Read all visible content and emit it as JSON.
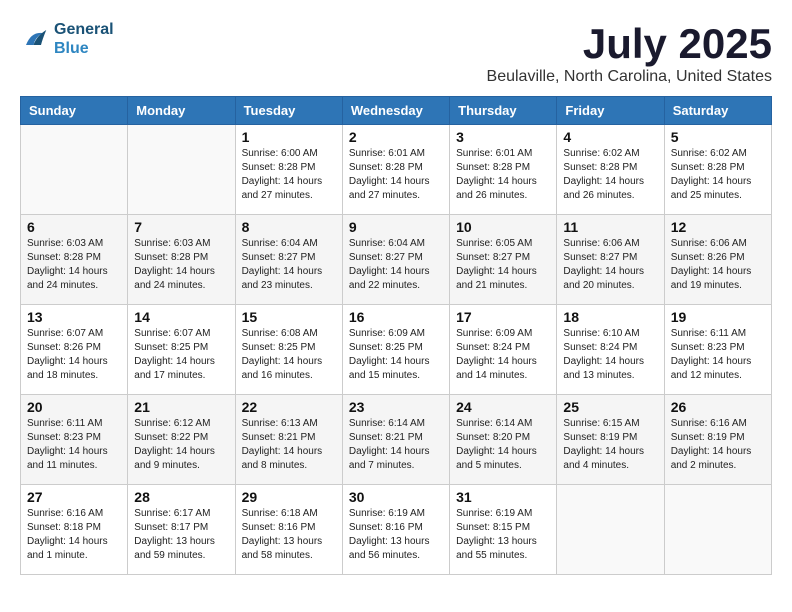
{
  "header": {
    "logo_line1": "General",
    "logo_line2": "Blue",
    "month": "July 2025",
    "location": "Beulaville, North Carolina, United States"
  },
  "weekdays": [
    "Sunday",
    "Monday",
    "Tuesday",
    "Wednesday",
    "Thursday",
    "Friday",
    "Saturday"
  ],
  "weeks": [
    [
      {
        "day": "",
        "info": ""
      },
      {
        "day": "",
        "info": ""
      },
      {
        "day": "1",
        "info": "Sunrise: 6:00 AM\nSunset: 8:28 PM\nDaylight: 14 hours\nand 27 minutes."
      },
      {
        "day": "2",
        "info": "Sunrise: 6:01 AM\nSunset: 8:28 PM\nDaylight: 14 hours\nand 27 minutes."
      },
      {
        "day": "3",
        "info": "Sunrise: 6:01 AM\nSunset: 8:28 PM\nDaylight: 14 hours\nand 26 minutes."
      },
      {
        "day": "4",
        "info": "Sunrise: 6:02 AM\nSunset: 8:28 PM\nDaylight: 14 hours\nand 26 minutes."
      },
      {
        "day": "5",
        "info": "Sunrise: 6:02 AM\nSunset: 8:28 PM\nDaylight: 14 hours\nand 25 minutes."
      }
    ],
    [
      {
        "day": "6",
        "info": "Sunrise: 6:03 AM\nSunset: 8:28 PM\nDaylight: 14 hours\nand 24 minutes."
      },
      {
        "day": "7",
        "info": "Sunrise: 6:03 AM\nSunset: 8:28 PM\nDaylight: 14 hours\nand 24 minutes."
      },
      {
        "day": "8",
        "info": "Sunrise: 6:04 AM\nSunset: 8:27 PM\nDaylight: 14 hours\nand 23 minutes."
      },
      {
        "day": "9",
        "info": "Sunrise: 6:04 AM\nSunset: 8:27 PM\nDaylight: 14 hours\nand 22 minutes."
      },
      {
        "day": "10",
        "info": "Sunrise: 6:05 AM\nSunset: 8:27 PM\nDaylight: 14 hours\nand 21 minutes."
      },
      {
        "day": "11",
        "info": "Sunrise: 6:06 AM\nSunset: 8:27 PM\nDaylight: 14 hours\nand 20 minutes."
      },
      {
        "day": "12",
        "info": "Sunrise: 6:06 AM\nSunset: 8:26 PM\nDaylight: 14 hours\nand 19 minutes."
      }
    ],
    [
      {
        "day": "13",
        "info": "Sunrise: 6:07 AM\nSunset: 8:26 PM\nDaylight: 14 hours\nand 18 minutes."
      },
      {
        "day": "14",
        "info": "Sunrise: 6:07 AM\nSunset: 8:25 PM\nDaylight: 14 hours\nand 17 minutes."
      },
      {
        "day": "15",
        "info": "Sunrise: 6:08 AM\nSunset: 8:25 PM\nDaylight: 14 hours\nand 16 minutes."
      },
      {
        "day": "16",
        "info": "Sunrise: 6:09 AM\nSunset: 8:25 PM\nDaylight: 14 hours\nand 15 minutes."
      },
      {
        "day": "17",
        "info": "Sunrise: 6:09 AM\nSunset: 8:24 PM\nDaylight: 14 hours\nand 14 minutes."
      },
      {
        "day": "18",
        "info": "Sunrise: 6:10 AM\nSunset: 8:24 PM\nDaylight: 14 hours\nand 13 minutes."
      },
      {
        "day": "19",
        "info": "Sunrise: 6:11 AM\nSunset: 8:23 PM\nDaylight: 14 hours\nand 12 minutes."
      }
    ],
    [
      {
        "day": "20",
        "info": "Sunrise: 6:11 AM\nSunset: 8:23 PM\nDaylight: 14 hours\nand 11 minutes."
      },
      {
        "day": "21",
        "info": "Sunrise: 6:12 AM\nSunset: 8:22 PM\nDaylight: 14 hours\nand 9 minutes."
      },
      {
        "day": "22",
        "info": "Sunrise: 6:13 AM\nSunset: 8:21 PM\nDaylight: 14 hours\nand 8 minutes."
      },
      {
        "day": "23",
        "info": "Sunrise: 6:14 AM\nSunset: 8:21 PM\nDaylight: 14 hours\nand 7 minutes."
      },
      {
        "day": "24",
        "info": "Sunrise: 6:14 AM\nSunset: 8:20 PM\nDaylight: 14 hours\nand 5 minutes."
      },
      {
        "day": "25",
        "info": "Sunrise: 6:15 AM\nSunset: 8:19 PM\nDaylight: 14 hours\nand 4 minutes."
      },
      {
        "day": "26",
        "info": "Sunrise: 6:16 AM\nSunset: 8:19 PM\nDaylight: 14 hours\nand 2 minutes."
      }
    ],
    [
      {
        "day": "27",
        "info": "Sunrise: 6:16 AM\nSunset: 8:18 PM\nDaylight: 14 hours\nand 1 minute."
      },
      {
        "day": "28",
        "info": "Sunrise: 6:17 AM\nSunset: 8:17 PM\nDaylight: 13 hours\nand 59 minutes."
      },
      {
        "day": "29",
        "info": "Sunrise: 6:18 AM\nSunset: 8:16 PM\nDaylight: 13 hours\nand 58 minutes."
      },
      {
        "day": "30",
        "info": "Sunrise: 6:19 AM\nSunset: 8:16 PM\nDaylight: 13 hours\nand 56 minutes."
      },
      {
        "day": "31",
        "info": "Sunrise: 6:19 AM\nSunset: 8:15 PM\nDaylight: 13 hours\nand 55 minutes."
      },
      {
        "day": "",
        "info": ""
      },
      {
        "day": "",
        "info": ""
      }
    ]
  ]
}
